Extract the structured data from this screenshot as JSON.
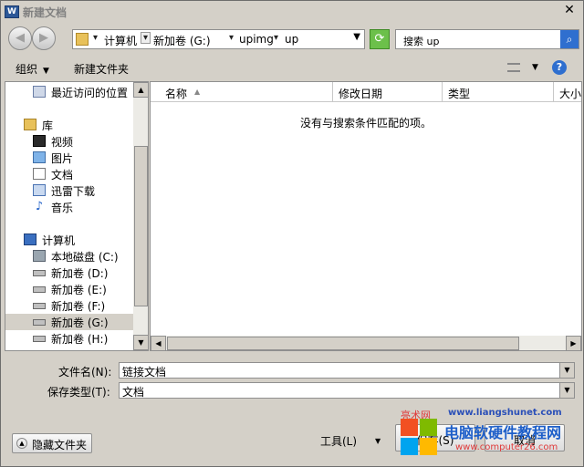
{
  "window": {
    "title": "新建文档",
    "app_icon_letter": "W",
    "close_glyph": "✕"
  },
  "nav": {
    "back_glyph": "◀",
    "forward_glyph": "▶",
    "breadcrumbs": [
      "计算机",
      "新加卷 (G:)",
      "upimg",
      "up"
    ],
    "search_placeholder": "搜索 up",
    "search_icon": "search-icon",
    "refresh_icon": "refresh-icon"
  },
  "toolbar": {
    "organize_label": "组织",
    "new_folder_label": "新建文件夹",
    "help_glyph": "?"
  },
  "sidebar": {
    "items": [
      {
        "label": "最近访问的位置",
        "icon": "recent-places-icon"
      },
      {
        "label": "库",
        "icon": "library-icon"
      },
      {
        "label": "视频",
        "icon": "video-icon"
      },
      {
        "label": "图片",
        "icon": "pictures-icon"
      },
      {
        "label": "文档",
        "icon": "documents-icon"
      },
      {
        "label": "迅雷下载",
        "icon": "thunder-download-icon"
      },
      {
        "label": "音乐",
        "icon": "music-icon"
      },
      {
        "label": "计算机",
        "icon": "computer-icon"
      },
      {
        "label": "本地磁盘 (C:)",
        "icon": "system-drive-icon"
      },
      {
        "label": "新加卷 (D:)",
        "icon": "drive-icon"
      },
      {
        "label": "新加卷 (E:)",
        "icon": "drive-icon"
      },
      {
        "label": "新加卷 (F:)",
        "icon": "drive-icon"
      },
      {
        "label": "新加卷 (G:)",
        "icon": "drive-icon",
        "selected": true
      },
      {
        "label": "新加卷 (H:)",
        "icon": "drive-icon"
      }
    ]
  },
  "filelist": {
    "columns": [
      "名称",
      "修改日期",
      "类型",
      "大小"
    ],
    "empty_message": "没有与搜索条件匹配的项。"
  },
  "form": {
    "filename_label": "文件名(N):",
    "filename_value": "链接文档",
    "filetype_label": "保存类型(T):",
    "filetype_value": "文档"
  },
  "footer": {
    "hide_folders_label": "隐藏文件夹",
    "tools_label": "工具(L)",
    "save_label": "保存(S)",
    "cancel_label": "取消"
  },
  "watermark": {
    "site_prefix": "亮术网",
    "site1": "www.liangshunet.com",
    "title": "电脑软硬件教程网",
    "site2": "www.computer26.com"
  },
  "colors": {
    "dialog_bg": "#d4d0c8",
    "selection": "#d4d0c8",
    "accent_blue": "#2f6fcf",
    "refresh_green": "#6cc04a"
  }
}
